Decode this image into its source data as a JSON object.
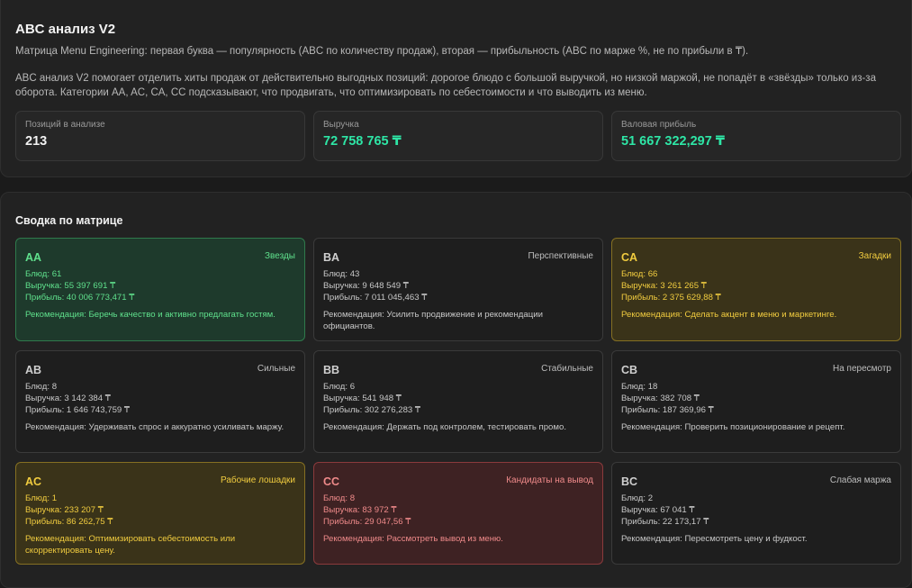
{
  "header": {
    "title": "ABC анализ V2",
    "subtitle": "Матрица Menu Engineering: первая буква — популярность (ABC по количеству продаж), вторая — прибыльность (ABC по марже %, не по прибыли в ₸).",
    "description": "ABC анализ V2 помогает отделить хиты продаж от действительно выгодных позиций: дорогое блюдо с большой выручкой, но низкой маржой, не попадёт в «звёзды» только из-за оборота. Категории AA, AC, CA, CC подсказывают, что продвигать, что оптимизировать по себестоимости и что выводить из меню."
  },
  "kpis": [
    {
      "label": "Позиций в анализе",
      "value": "213"
    },
    {
      "label": "Выручка",
      "value": "72 758 765 ₸"
    },
    {
      "label": "Валовая прибыль",
      "value": "51 667 322,297 ₸"
    }
  ],
  "matrix": {
    "title": "Сводка по матрице",
    "cards": [
      {
        "code": "AA",
        "tag": "Звезды",
        "dishes": "Блюд: 61",
        "revenue": "Выручка: 55 397 691 ₸",
        "profit": "Прибыль: 40 006 773,471 ₸",
        "rec": "Рекомендация: Беречь качество и активно предлагать гостям.",
        "theme": "green"
      },
      {
        "code": "BA",
        "tag": "Перспективные",
        "dishes": "Блюд: 43",
        "revenue": "Выручка: 9 648 549 ₸",
        "profit": "Прибыль: 7 011 045,463 ₸",
        "rec": "Рекомендация: Усилить продвижение и рекомендации официантов.",
        "theme": "plain"
      },
      {
        "code": "CA",
        "tag": "Загадки",
        "dishes": "Блюд: 66",
        "revenue": "Выручка: 3 261 265 ₸",
        "profit": "Прибыль: 2 375 629,88 ₸",
        "rec": "Рекомендация: Сделать акцент в меню и маркетинге.",
        "theme": "gold"
      },
      {
        "code": "AB",
        "tag": "Сильные",
        "dishes": "Блюд: 8",
        "revenue": "Выручка: 3 142 384 ₸",
        "profit": "Прибыль: 1 646 743,759 ₸",
        "rec": "Рекомендация: Удерживать спрос и аккуратно усиливать маржу.",
        "theme": "plain"
      },
      {
        "code": "BB",
        "tag": "Стабильные",
        "dishes": "Блюд: 6",
        "revenue": "Выручка: 541 948 ₸",
        "profit": "Прибыль: 302 276,283 ₸",
        "rec": "Рекомендация: Держать под контролем, тестировать промо.",
        "theme": "plain"
      },
      {
        "code": "CB",
        "tag": "На пересмотр",
        "dishes": "Блюд: 18",
        "revenue": "Выручка: 382 708 ₸",
        "profit": "Прибыль: 187 369,96 ₸",
        "rec": "Рекомендация: Проверить позиционирование и рецепт.",
        "theme": "plain"
      },
      {
        "code": "AC",
        "tag": "Рабочие лошадки",
        "dishes": "Блюд: 1",
        "revenue": "Выручка: 233 207 ₸",
        "profit": "Прибыль: 86 262,75 ₸",
        "rec": "Рекомендация: Оптимизировать себестоимость или скорректировать цену.",
        "theme": "gold"
      },
      {
        "code": "CC",
        "tag": "Кандидаты на вывод",
        "dishes": "Блюд: 8",
        "revenue": "Выручка: 83 972 ₸",
        "profit": "Прибыль: 29 047,56 ₸",
        "rec": "Рекомендация: Рассмотреть вывод из меню.",
        "theme": "red"
      },
      {
        "code": "BC",
        "tag": "Слабая маржа",
        "dishes": "Блюд: 2",
        "revenue": "Выручка: 67 041 ₸",
        "profit": "Прибыль: 22 173,17 ₸",
        "rec": "Рекомендация: Пересмотреть цену и фудкост.",
        "theme": "plain"
      }
    ]
  },
  "colors": {
    "accent_green": "#2ee6a6",
    "card_green": "#5fe08c",
    "card_gold": "#f1cc3f",
    "card_red": "#ef8a8a"
  }
}
